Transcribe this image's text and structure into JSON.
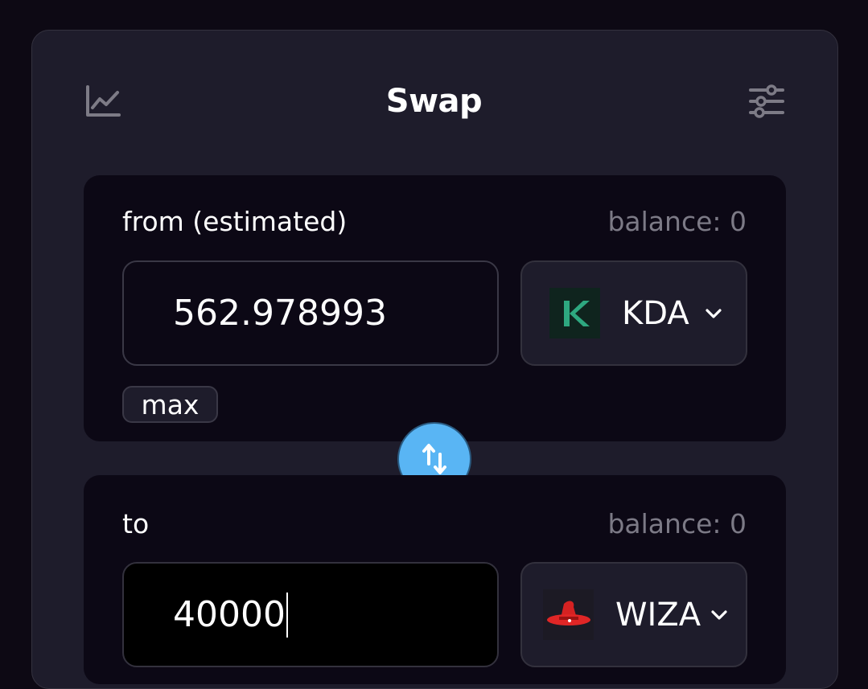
{
  "header": {
    "title": "Swap",
    "chart_icon": "chart-line-icon",
    "settings_icon": "sliders-icon"
  },
  "from": {
    "label": "from (estimated)",
    "balance": "balance: 0",
    "amount": "562.978993",
    "token": "KDA",
    "token_icon": "kda-logo-icon",
    "max_label": "max"
  },
  "to": {
    "label": "to",
    "balance": "balance: 0",
    "amount": "40000",
    "token": "WIZA",
    "token_icon": "wiza-hat-icon"
  },
  "switch_icon": "swap-arrows-icon",
  "colors": {
    "background": "#0d0914",
    "card": "#1e1c2b",
    "panel": "#0c0815",
    "accent": "#59b5f4",
    "muted_text": "#7c7a86",
    "kda_green": "#2ea880"
  }
}
